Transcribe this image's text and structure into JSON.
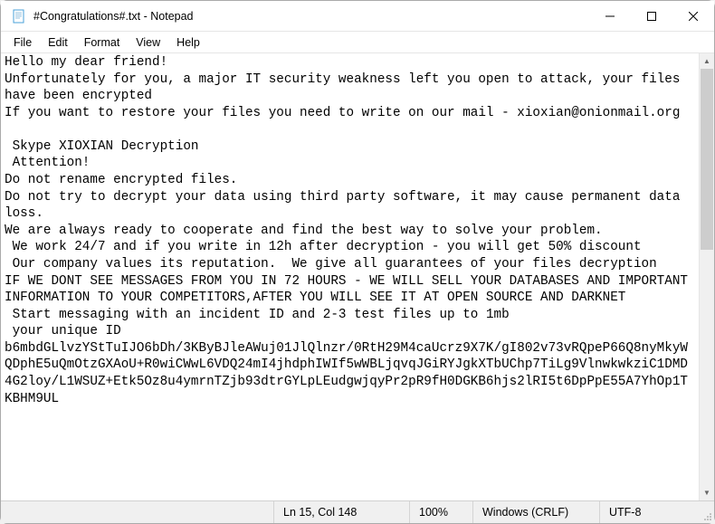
{
  "window": {
    "title": "#Congratulations#.txt - Notepad"
  },
  "menu": {
    "items": [
      "File",
      "Edit",
      "Format",
      "View",
      "Help"
    ]
  },
  "content": {
    "text": "Hello my dear friend!\nUnfortunately for you, a major IT security weakness left you open to attack, your files have been encrypted\nIf you want to restore your files you need to write on our mail - xioxian@onionmail.org\n\n Skype XIOXIAN Decryption\n Attention!\nDo not rename encrypted files.\nDo not try to decrypt your data using third party software, it may cause permanent data loss.\nWe are always ready to cooperate and find the best way to solve your problem.\n We work 24/7 and if you write in 12h after decryption - you will get 50% discount\n Our company values its reputation.  We give all guarantees of your files decryption\nIF WE DONT SEE MESSAGES FROM YOU IN 72 HOURS - WE WILL SELL YOUR DATABASES AND IMPORTANT INFORMATION TO YOUR COMPETITORS,AFTER YOU WILL SEE IT AT OPEN SOURCE AND DARKNET\n Start messaging with an incident ID and 2-3 test files up to 1mb\n your unique ID\nb6mbdGLlvzYStTuIJO6bDh/3KByBJleAWuj01JlQlnzr/0RtH29M4caUcrz9X7K/gI802v73vRQpeP66Q8nyMkyWQDphE5uQmOtzGXAoU+R0wiCWwL6VDQ24mI4jhdphIWIf5wWBLjqvqJGiRYJgkXTbUChp7TiLg9VlnwkwkziC1DMD4G2loy/L1WSUZ+Etk5Oz8u4ymrnTZjb93dtrGYLpLEudgwjqyPr2pR9fH0DGKB6hjs2lRI5t6DpPpE55A7YhOp1TKBHM9UL"
  },
  "status": {
    "position": "Ln 15, Col 148",
    "zoom": "100%",
    "eol": "Windows (CRLF)",
    "encoding": "UTF-8"
  }
}
